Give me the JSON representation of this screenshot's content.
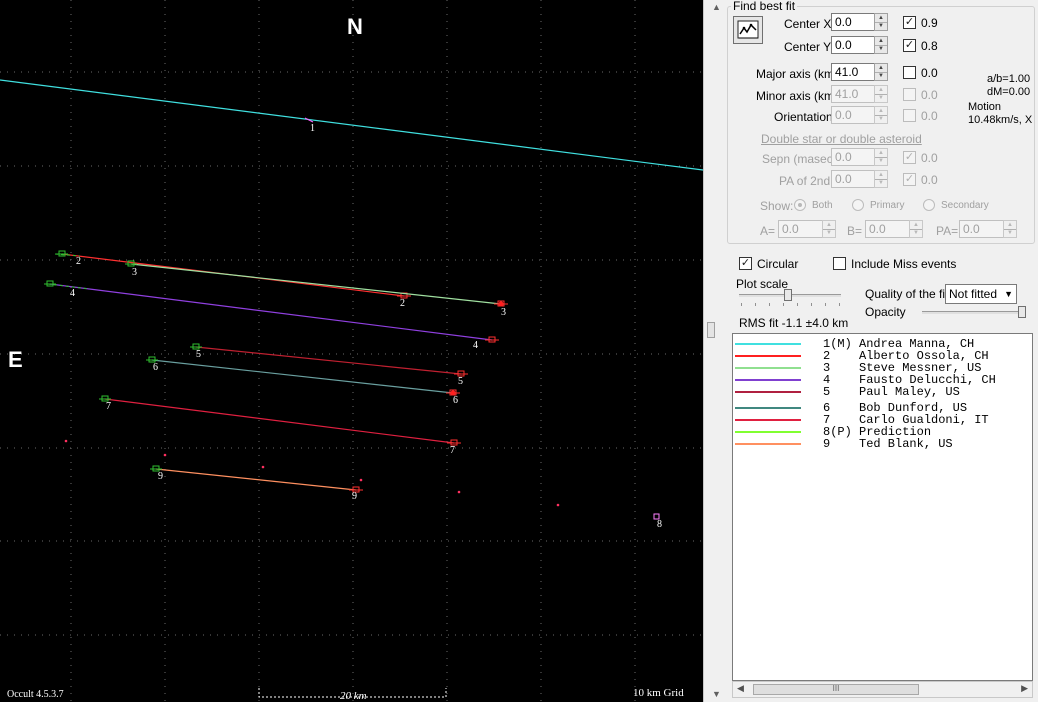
{
  "plot": {
    "north_label": "N",
    "east_label": "E",
    "version": "Occult 4.5.3.7",
    "scale_bar_label": "20 km",
    "grid_label": "10 km Grid",
    "background": "#000000",
    "chords": [
      {
        "id": "1",
        "color": "#40e0e0"
      },
      {
        "id": "2",
        "color": "#ff3030"
      },
      {
        "id": "3",
        "color": "#a0e0a0"
      },
      {
        "id": "4",
        "color": "#9040e0"
      },
      {
        "id": "5",
        "color": "#c02030"
      },
      {
        "id": "6",
        "color": "#6aa0a0"
      },
      {
        "id": "7",
        "color": "#e02040"
      },
      {
        "id": "8",
        "color": "#90ff40"
      },
      {
        "id": "9",
        "color": "#ff9060"
      }
    ]
  },
  "fit": {
    "group_title": "Find best fit",
    "fit_button_icon": "fit-chart-icon",
    "center_x": {
      "label": "Center X",
      "value": "0.0",
      "check_value": "0.9",
      "checked": true
    },
    "center_y": {
      "label": "Center Y",
      "value": "0.0",
      "check_value": "0.8",
      "checked": true
    },
    "major_axis": {
      "label": "Major axis (km)",
      "value": "41.0",
      "check_value": "0.0",
      "checked": false
    },
    "minor_axis": {
      "label": "Minor axis (km)",
      "value": "41.0",
      "check_value": "0.0",
      "checked": false
    },
    "orientation": {
      "label": "Orientation",
      "value": "0.0",
      "check_value": "0.0",
      "checked": false
    },
    "ratio": "a/b=1.00",
    "dm": "dM=0.00",
    "motion_label": "Motion",
    "motion_value": "10.48km/s, X",
    "double_link": "Double star  or  double asteroid",
    "sepn": {
      "label": "Sepn (masec)",
      "value": "0.0",
      "check_value": "0.0",
      "checked": true
    },
    "pa2": {
      "label": "PA of 2nd",
      "value": "0.0",
      "check_value": "0.0",
      "checked": true
    },
    "show_label": "Show:",
    "show_options": [
      "Both",
      "Primary",
      "Secondary"
    ],
    "a": {
      "label": "A=",
      "value": "0.0"
    },
    "b": {
      "label": "B=",
      "value": "0.0"
    },
    "pa": {
      "label": "PA=",
      "value": "0.0"
    },
    "circular": {
      "label": "Circular",
      "checked": true
    },
    "include_miss": {
      "label": "Include Miss events",
      "checked": false
    },
    "plot_scale_label": "Plot scale",
    "quality_label": "Quality of the fit",
    "quality_value": "Not fitted",
    "opacity_label": "Opacity",
    "rms": "RMS fit -1.1 ±4.0 km"
  },
  "legend": [
    {
      "text": "1(M) Andrea Manna, CH",
      "color": "#40e0e0"
    },
    {
      "text": "2    Alberto Ossola, CH",
      "color": "#ff2020"
    },
    {
      "text": "3    Steve Messner, US",
      "color": "#90e090"
    },
    {
      "text": "4    Fausto Delucchi, CH",
      "color": "#8040d0"
    },
    {
      "text": "5    Paul Maley, US",
      "color": "#b02040"
    },
    {
      "text": "6    Bob Dunford, US",
      "color": "#408880"
    },
    {
      "text": "7    Carlo Gualdoni, IT",
      "color": "#e02040"
    },
    {
      "text": "8(P) Prediction",
      "color": "#80ff30"
    },
    {
      "text": "9    Ted Blank, US",
      "color": "#ff9060"
    }
  ],
  "scroll": {
    "thumb_glyph": "III"
  }
}
